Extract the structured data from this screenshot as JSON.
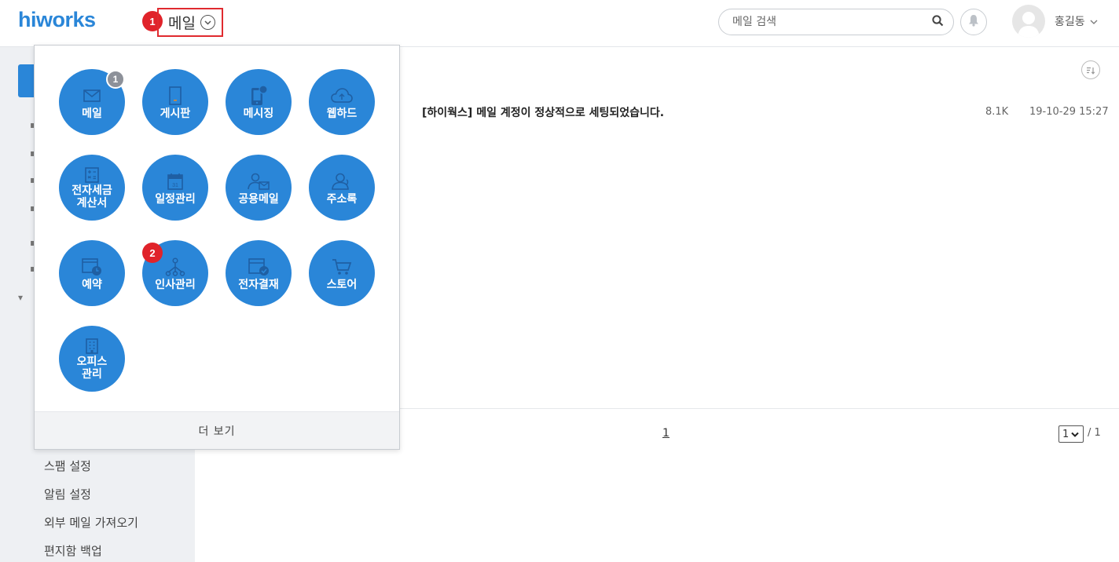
{
  "header": {
    "logo": "hiworks",
    "app_switch_label": "메일",
    "step1": "1",
    "search_placeholder": "메일 검색",
    "username": "홍길동"
  },
  "sidebar": {
    "items": [
      "스팸 설정",
      "알림 설정",
      "외부 메일 가져오기",
      "편지함 백업"
    ]
  },
  "mail": {
    "subject": "[하이웍스] 메일 계정이 정상적으로 세팅되었습니다.",
    "size": "8.1K",
    "date": "19-10-29 15:27"
  },
  "pagination": {
    "current": "1",
    "select_value": "1",
    "total": "/ 1"
  },
  "apps_popup": {
    "apps": [
      {
        "name": "메일",
        "icon": "envelope-icon",
        "badge": "1"
      },
      {
        "name": "게시판",
        "icon": "board-icon"
      },
      {
        "name": "메시징",
        "icon": "phone-icon"
      },
      {
        "name": "웹하드",
        "icon": "cloud-icon"
      },
      {
        "name": "전자세금\n계산서",
        "icon": "calculator-icon"
      },
      {
        "name": "일정관리",
        "icon": "calendar-icon"
      },
      {
        "name": "공용메일",
        "icon": "shared-mail-icon"
      },
      {
        "name": "주소록",
        "icon": "contacts-icon"
      },
      {
        "name": "예약",
        "icon": "reservation-icon"
      },
      {
        "name": "인사관리",
        "icon": "org-chart-icon"
      },
      {
        "name": "전자결재",
        "icon": "approval-icon"
      },
      {
        "name": "스토어",
        "icon": "cart-icon"
      },
      {
        "name": "오피스\n관리",
        "icon": "building-icon"
      }
    ],
    "step2": "2",
    "more_label": "더 보기"
  },
  "colors": {
    "brand_blue": "#2a86d8",
    "highlight_red": "#e02a2f",
    "sidebar_bg": "#eef0f3"
  }
}
